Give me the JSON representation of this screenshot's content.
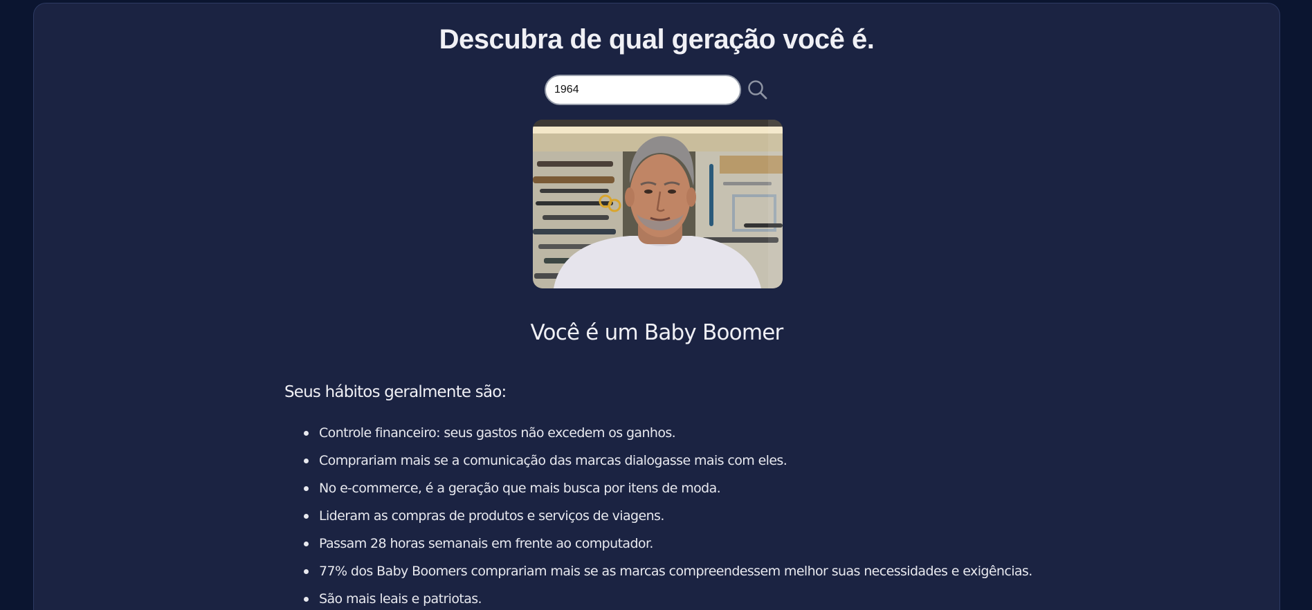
{
  "page": {
    "title": "Descubra de qual geração você é."
  },
  "search": {
    "value": "1964",
    "icon": "search-icon"
  },
  "photo": {
    "description_icon": "person-photo"
  },
  "result": {
    "text": "Você é um Baby Boomer"
  },
  "habits": {
    "title": "Seus hábitos geralmente são:",
    "items": [
      "Controle financeiro: seus gastos não excedem os ganhos.",
      "Comprariam mais se a comunicação das marcas dialogasse mais com eles.",
      "No e-commerce, é a geração que mais busca por itens de moda.",
      "Lideram as compras de produtos e serviços de viagens.",
      "Passam 28 horas semanais em frente ao computador.",
      "77% dos Baby Boomers comprariam mais se as marcas compreendessem melhor suas necessidades e exigências.",
      "São mais leais e patriotas."
    ]
  },
  "colors": {
    "background": "#0b1530",
    "card": "#1b2342",
    "text": "#f0f0f5"
  }
}
